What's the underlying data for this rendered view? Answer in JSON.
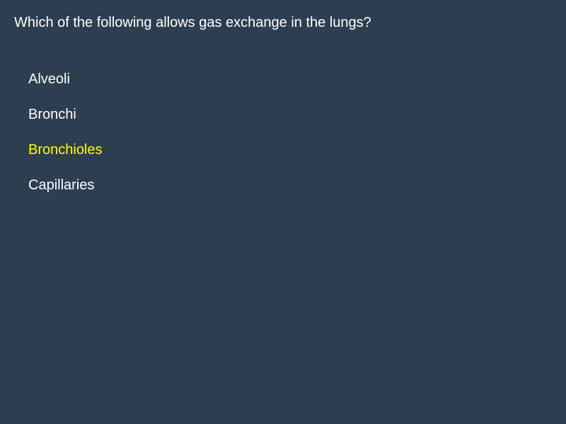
{
  "quiz": {
    "question": "Which of the following allows gas exchange in the lungs?",
    "options": [
      {
        "label": "Alveoli",
        "highlighted": false
      },
      {
        "label": "Bronchi",
        "highlighted": false
      },
      {
        "label": "Bronchioles",
        "highlighted": true
      },
      {
        "label": "Capillaries",
        "highlighted": false
      }
    ]
  },
  "colors": {
    "background": "#2d3e50",
    "text": "#ffffff",
    "highlight": "#ffff00"
  }
}
